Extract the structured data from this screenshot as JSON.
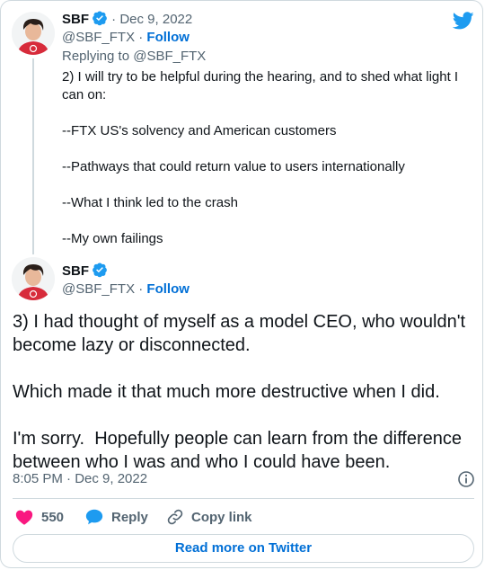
{
  "colors": {
    "accent": "#1d9bf0",
    "link": "#006fd6",
    "like": "#f91880",
    "text": "#0f1419",
    "muted": "#536471"
  },
  "reply_tweet": {
    "name": "SBF",
    "date": "· Dec 9, 2022",
    "handle": "@SBF_FTX",
    "sep": " · ",
    "follow": "Follow",
    "replying_to": "Replying to @SBF_FTX",
    "text": "2) I will try to be helpful during the hearing, and to shed what light I can on:\n\n--FTX US's solvency and American customers\n\n--Pathways that could return value to users internationally\n\n--What I think led to the crash\n\n--My own failings"
  },
  "main_tweet": {
    "name": "SBF",
    "handle": "@SBF_FTX",
    "sep": " · ",
    "follow": "Follow",
    "text": "3) I had thought of myself as a model CEO, who wouldn't become lazy or disconnected.\n\nWhich made it that much more destructive when I did.\n\nI'm sorry.  Hopefully people can learn from the difference between who I was and who I could have been.",
    "timestamp": "8:05 PM · Dec 9, 2022"
  },
  "actions": {
    "likes": "550",
    "reply": "Reply",
    "copy_link": "Copy link"
  },
  "read_more": "Read more on Twitter"
}
